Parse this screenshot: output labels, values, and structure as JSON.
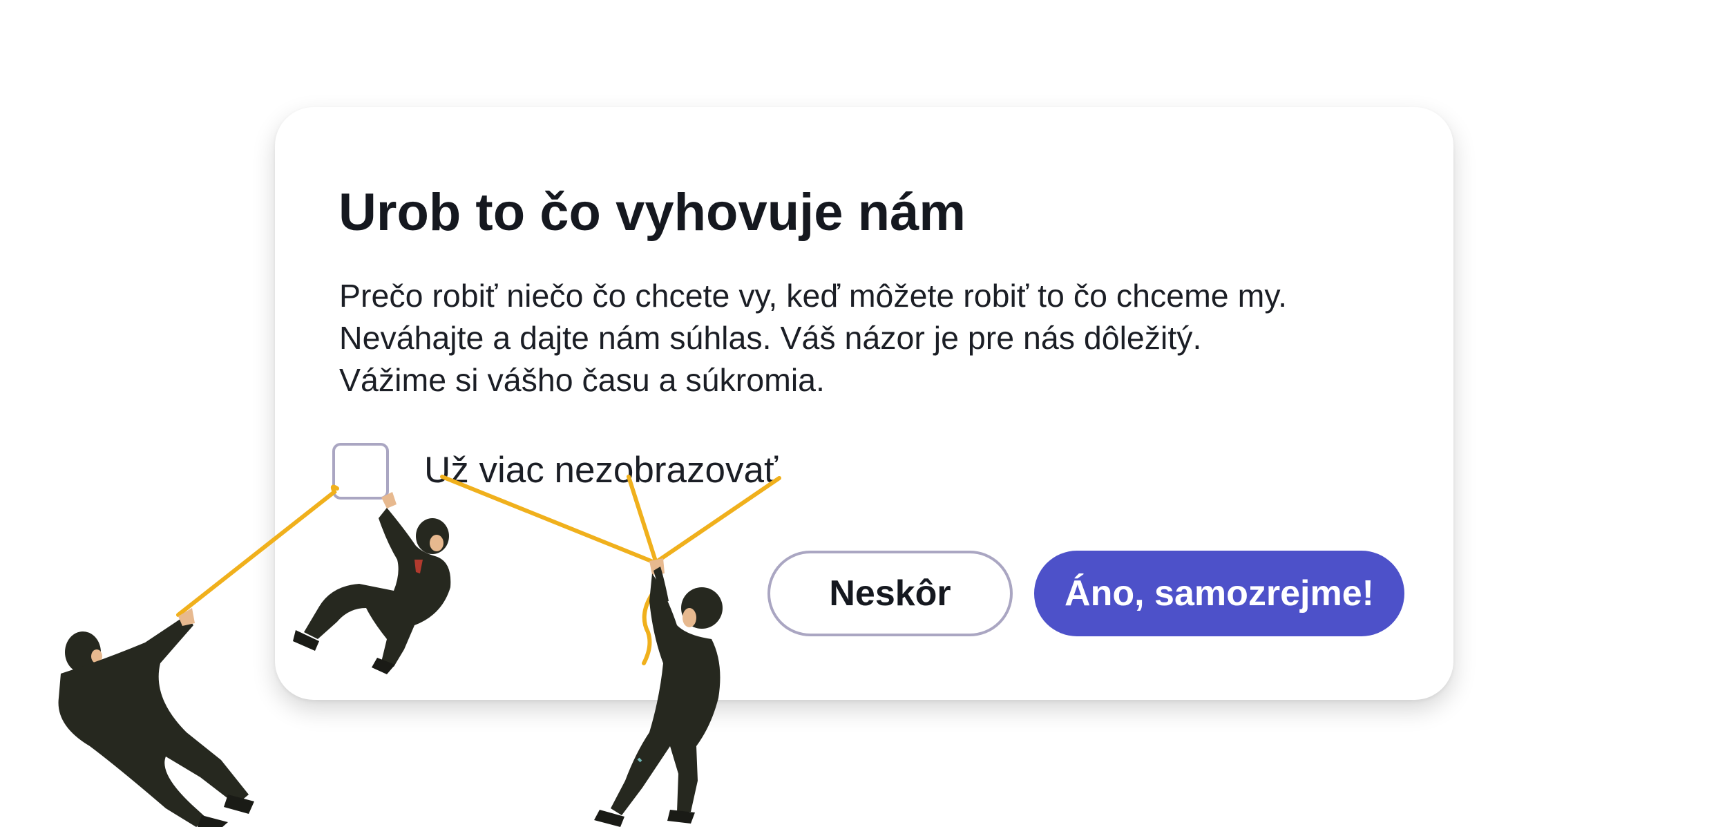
{
  "dialog": {
    "title": "Urob to čo vyhovuje nám",
    "body_lines": [
      "Prečo robiť niečo čo chcete vy, keď môžete robiť to čo chceme my.",
      "Neváhajte a dajte nám súhlas. Váš názor je pre nás dôležitý.",
      "Vážime si vášho času a súkromia."
    ],
    "checkbox": {
      "label": "Už viac nezobrazovať",
      "checked": false
    },
    "buttons": {
      "later_label": "Neskôr",
      "accept_label": "Áno, samozrejme!"
    }
  },
  "colors": {
    "accent": "#4d51c9",
    "outline": "#aaa6c2",
    "text": "#15181f",
    "rope": "#f0b01c",
    "suit": "#26281f"
  },
  "illustration": {
    "icons": [
      "businessman-pulling-rope-icon",
      "businessman-hanging-icon",
      "businessman-tugging-icon"
    ]
  }
}
